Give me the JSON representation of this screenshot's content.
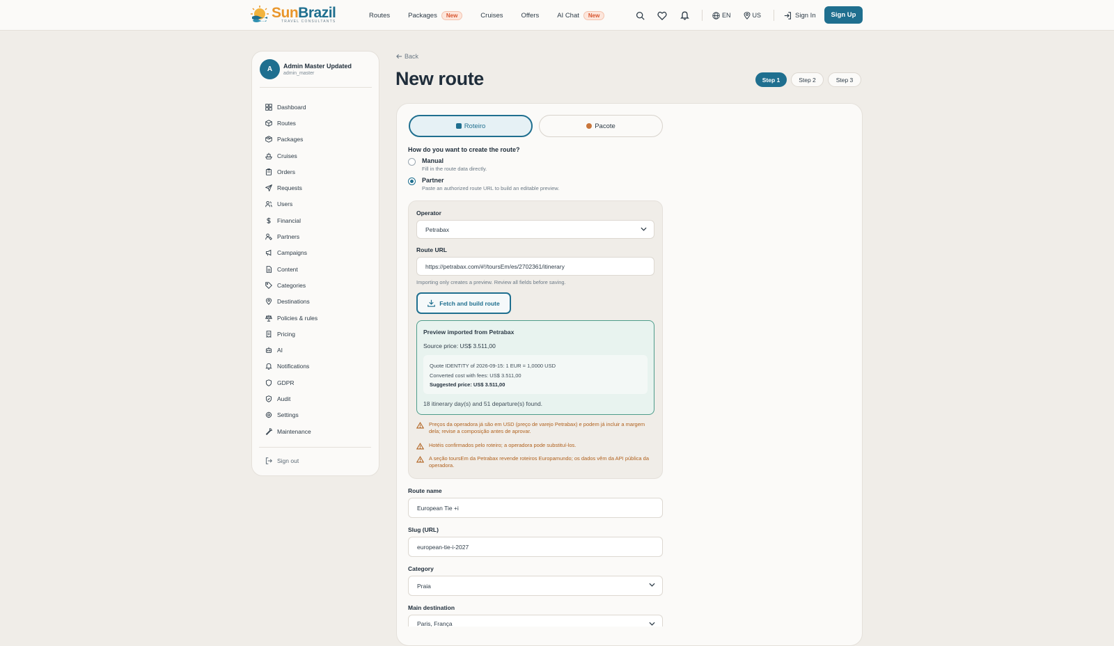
{
  "brand": {
    "name_part1": "Sun",
    "name_part2": "Brazil",
    "tagline": "TRAVEL CONSULTANTS"
  },
  "nav": {
    "items": [
      {
        "label": "Routes",
        "badge": ""
      },
      {
        "label": "Packages",
        "badge": "New"
      },
      {
        "label": "Cruises",
        "badge": ""
      },
      {
        "label": "Offers",
        "badge": ""
      },
      {
        "label": "AI Chat",
        "badge": "New"
      }
    ],
    "language": "EN",
    "region": "US",
    "sign_in": "Sign In",
    "sign_up": "Sign Up"
  },
  "sidebar": {
    "user_initial": "A",
    "user_name": "Admin Master Updated",
    "username": "admin_master",
    "items": [
      {
        "label": "Dashboard",
        "icon": "grid-icon"
      },
      {
        "label": "Routes",
        "icon": "box-icon"
      },
      {
        "label": "Packages",
        "icon": "package-icon"
      },
      {
        "label": "Cruises",
        "icon": "ship-icon"
      },
      {
        "label": "Orders",
        "icon": "clipboard-icon"
      },
      {
        "label": "Requests",
        "icon": "send-icon"
      },
      {
        "label": "Users",
        "icon": "users-icon"
      },
      {
        "label": "Financial",
        "icon": "dollar-icon"
      },
      {
        "label": "Partners",
        "icon": "handshake-icon"
      },
      {
        "label": "Campaigns",
        "icon": "megaphone-icon"
      },
      {
        "label": "Content",
        "icon": "file-icon"
      },
      {
        "label": "Categories",
        "icon": "tag-icon"
      },
      {
        "label": "Destinations",
        "icon": "map-pin-icon"
      },
      {
        "label": "Policies & rules",
        "icon": "scale-icon"
      },
      {
        "label": "Pricing",
        "icon": "receipt-icon"
      },
      {
        "label": "AI",
        "icon": "bot-icon"
      },
      {
        "label": "Notifications",
        "icon": "bell-icon"
      },
      {
        "label": "GDPR",
        "icon": "shield-icon"
      },
      {
        "label": "Audit",
        "icon": "shield-check-icon"
      },
      {
        "label": "Settings",
        "icon": "gear-icon"
      },
      {
        "label": "Maintenance",
        "icon": "wrench-icon"
      }
    ],
    "sign_out": "Sign out"
  },
  "page": {
    "back": "Back",
    "title": "New route",
    "steps": [
      "Step 1",
      "Step 2",
      "Step 3"
    ],
    "active_step": 0
  },
  "form": {
    "type_tabs": [
      {
        "label": "Roteiro",
        "active": true
      },
      {
        "label": "Pacote",
        "active": false
      }
    ],
    "question": "How do you want to create the route?",
    "options": [
      {
        "label": "Manual",
        "description": "Fill in the route data directly.",
        "selected": false
      },
      {
        "label": "Partner",
        "description": "Paste an authorized route URL to build an editable preview.",
        "selected": true
      }
    ],
    "operator_label": "Operator",
    "operator_value": "Petrabax",
    "route_url_label": "Route URL",
    "route_url_value": "https://petrabax.com/#!/toursEm/es/2702361/itinerary",
    "import_hint": "Importing only creates a preview. Review all fields before saving.",
    "fetch_button": "Fetch and build route",
    "preview": {
      "title": "Preview imported from Petrabax",
      "source_price": "Source price: US$ 3.511,00",
      "quote": "Quote IDENTITY of 2026-09-15: 1 EUR = 1,0000 USD",
      "converted": "Converted cost with fees: US$ 3.511,00",
      "suggested": "Suggested price: US$ 3.511,00",
      "found": "18 itinerary day(s) and 51 departure(s) found."
    },
    "warnings": [
      "Preços da operadora já são em USD (preço de varejo Petrabax) e podem já incluir a margem dela; revise a composição antes de aprovar.",
      "Hotéis confirmados pelo roteiro; a operadora pode substituí-los.",
      "A seção toursEm da Petrabax revende roteiros Europamundo; os dados vêm da API pública da operadora."
    ],
    "route_name_label": "Route name",
    "route_name_value": "European Tie +i",
    "slug_label": "Slug (URL)",
    "slug_value": "european-tie-i-2027",
    "category_label": "Category",
    "category_value": "Praia",
    "destination_label": "Main destination",
    "destination_value": "Paris, França"
  },
  "colors": {
    "primary": "#1f6f8f",
    "accent": "#e9962b",
    "badge": "#d8552f",
    "warning": "#b0611d",
    "success_border": "#4d9c8a"
  }
}
